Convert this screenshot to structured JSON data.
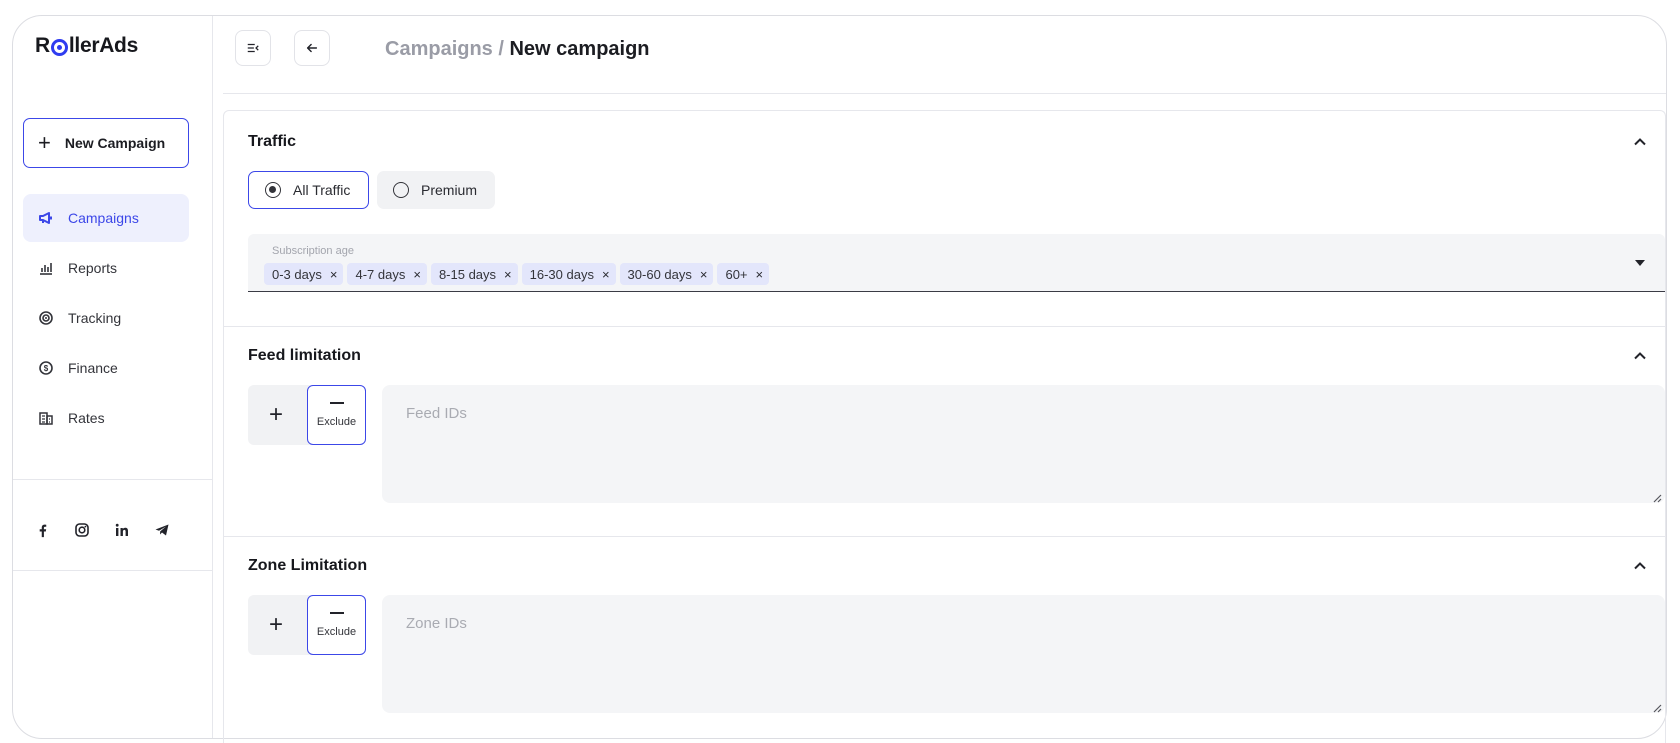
{
  "brand": {
    "logo_pre": "R",
    "logo_post": "llerAds",
    "accent": "#3c47e8"
  },
  "sidebar": {
    "new_campaign_label": "New Campaign",
    "items": [
      {
        "label": "Campaigns",
        "icon": "megaphone-icon",
        "active": true
      },
      {
        "label": "Reports",
        "icon": "chart-icon",
        "active": false
      },
      {
        "label": "Tracking",
        "icon": "target-icon",
        "active": false
      },
      {
        "label": "Finance",
        "icon": "dollar-icon",
        "active": false
      },
      {
        "label": "Rates",
        "icon": "building-icon",
        "active": false
      }
    ],
    "socials": [
      "facebook-icon",
      "instagram-icon",
      "linkedin-icon",
      "telegram-icon"
    ]
  },
  "header": {
    "breadcrumb_prev": "Campaigns",
    "breadcrumb_sep": " / ",
    "breadcrumb_current": "New campaign"
  },
  "traffic": {
    "title": "Traffic",
    "options": [
      {
        "label": "All Traffic",
        "selected": true
      },
      {
        "label": "Premium",
        "selected": false
      }
    ],
    "subscription_label": "Subscription age",
    "chips": [
      "0-3 days",
      "4-7 days",
      "8-15 days",
      "16-30 days",
      "30-60 days",
      "60+"
    ],
    "chip_remove_glyph": "×"
  },
  "feed": {
    "title": "Feed limitation",
    "include_glyph": "+",
    "exclude_label": "Exclude",
    "placeholder": "Feed IDs"
  },
  "zone": {
    "title": "Zone Limitation",
    "include_glyph": "+",
    "exclude_label": "Exclude",
    "placeholder": "Zone IDs"
  }
}
